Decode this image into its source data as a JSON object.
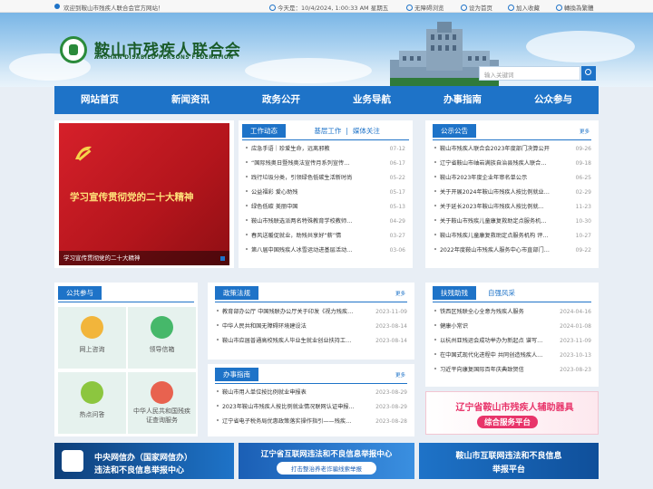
{
  "topbar": {
    "welcome": "欢迎到鞍山市残疾人联合会官方网站！",
    "today": "今天是：10/4/2024, 1:00:33 AM 星期五",
    "accessible": "无障碍浏览",
    "homepage": "设为首页",
    "favorite": "加入收藏",
    "traditional": "轉換為繁體"
  },
  "header": {
    "title_cn": "鞍山市残疾人联合会",
    "title_en": "ANSHAN DISABIED PERSONS FEDERATION",
    "search_placeholder": "输入关键词"
  },
  "nav": [
    "网站首页",
    "新闻资讯",
    "政务公开",
    "业务导航",
    "办事指南",
    "公众参与"
  ],
  "slider": {
    "headline": "学习宣传贯彻党的二十大精神",
    "caption": "学习宣传贯彻党的二十大精神"
  },
  "work": {
    "tab1": "工作动态",
    "tab2": "基层工作",
    "sep": "|",
    "tab3": "媒体关注",
    "items": [
      {
        "t": "应急手语｜珍爱生命，远离邪教",
        "d": "07-12"
      },
      {
        "t": "“国际残奥日暨残奥法宣传月系列宣传…",
        "d": "06-17"
      },
      {
        "t": "践行垃圾分类，引领绿色低碳生活新时尚",
        "d": "05-22"
      },
      {
        "t": "公益福彩 爱心助残",
        "d": "05-17"
      },
      {
        "t": "绿色低碳 美丽中国",
        "d": "05-13"
      },
      {
        "t": "鞍山市残联选派两名特殊教育学校教师…",
        "d": "04-29"
      },
      {
        "t": "春风送暖促就业，助残共享好“薪”情",
        "d": "03-27"
      },
      {
        "t": "第八届中国残疾人冰雪运动进基层活动…",
        "d": "03-06"
      }
    ]
  },
  "notice": {
    "title": "公示公告",
    "more": "更多",
    "items": [
      {
        "t": "鞍山市残疾人联合会2023年度部门决算公开",
        "d": "09-26"
      },
      {
        "t": "辽宁省鞍山市岫岩满族自治县残疾人联合…",
        "d": "09-18"
      },
      {
        "t": "鞍山市2023年度企业年审名单公示",
        "d": "06-25"
      },
      {
        "t": "关于开展2024年鞍山市残疾人按比例就业…",
        "d": "02-29"
      },
      {
        "t": "关于延长2023年鞍山市残疾人按比例就…",
        "d": "11-23"
      },
      {
        "t": "关于鞍山市残疾儿童康复救助定点服务机…",
        "d": "10-30"
      },
      {
        "t": "鞍山市残疾儿童康复救助定点服务机构 评…",
        "d": "10-27"
      },
      {
        "t": "2022年度鞍山市残疾人服务中心市直部门…",
        "d": "09-22"
      }
    ]
  },
  "public": {
    "title": "公共参与",
    "items": [
      "网上咨询",
      "领导信箱",
      "热点问答",
      "中华人民共和国残疾证查询服务"
    ]
  },
  "policy": {
    "title": "政策法规",
    "more": "更多",
    "items": [
      {
        "t": "教育部办公厅 中国残联办公厅关于印发《视力残疾…",
        "d": "2023-11-09"
      },
      {
        "t": "中华人民共和国无障碍环境建设法",
        "d": "2023-08-14"
      },
      {
        "t": "鞍山市应届普通高校残疾人毕业生就业创业扶持工…",
        "d": "2023-08-14"
      }
    ]
  },
  "guide": {
    "title": "办事指南",
    "more": "更多",
    "items": [
      {
        "t": "鞍山市用人单位按比例就业申报表",
        "d": "2023-08-29"
      },
      {
        "t": "2023年鞍山市残疾人按比例就业情况联网认证申报…",
        "d": "2023-08-29"
      },
      {
        "t": "辽宁省电子税务局优惠政策落实操作指引——残疾…",
        "d": "2023-08-28"
      }
    ]
  },
  "help": {
    "tab1": "扶残助残",
    "tab2": "自强风采",
    "more": "更多",
    "items": [
      {
        "t": "铁西区残联全心全意为残疾人服务",
        "d": "2024-04-16"
      },
      {
        "t": "健康小常识",
        "d": "2024-01-08"
      },
      {
        "t": "以杭州亚残运会成功举办为新起点 谱写…",
        "d": "2023-11-09"
      },
      {
        "t": "在中国式现代化进程中 共同创造残疾人…",
        "d": "2023-10-13"
      },
      {
        "t": "习近平向康复国际百年庆典致贺信",
        "d": "2023-08-23"
      }
    ]
  },
  "promo": {
    "line1": "辽宁省鞍山市残疾人辅助器具",
    "line2": "综合服务平台"
  },
  "banners": {
    "b1_line1": "中央网信办（国家网信办）",
    "b1_line2": "违法和不良信息举报中心",
    "b2_line1": "辽宁省互联网违法和不良信息举报中心",
    "b2_line2": "打击整治养老诈骗线索举报",
    "b3_line1": "鞍山市互联网违法和不良信息",
    "b3_line2": "举报平台"
  },
  "colors": {
    "primary": "#1e73c8",
    "green": "#1a5c2a",
    "red": "#c8161d"
  }
}
